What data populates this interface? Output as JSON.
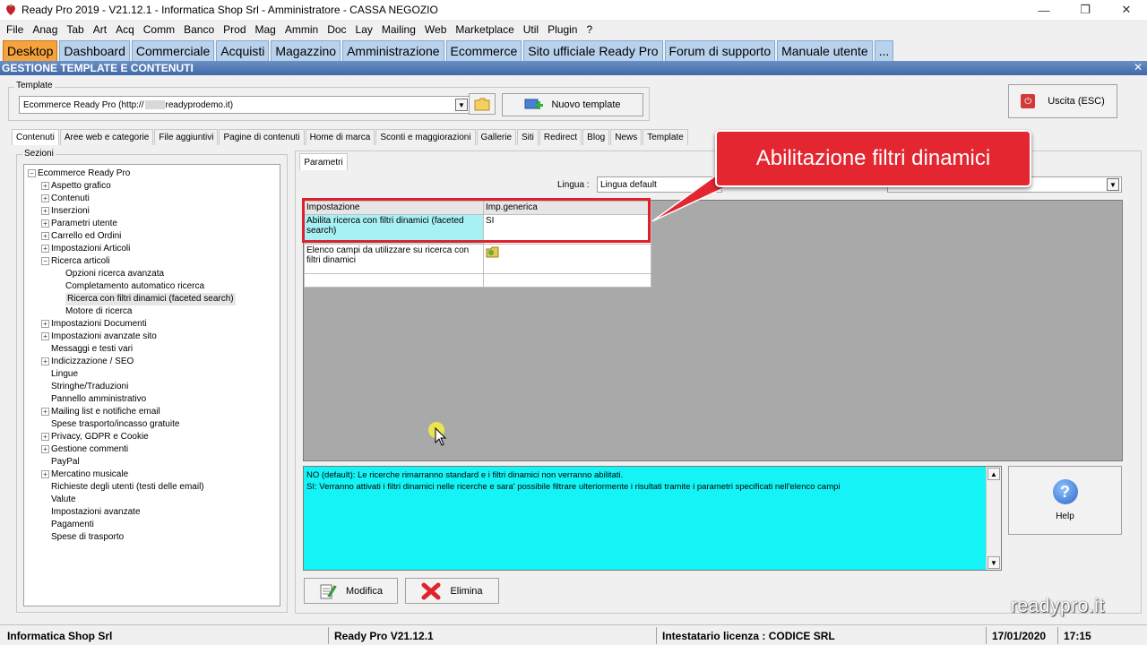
{
  "titlebar": {
    "title": "Ready Pro 2019 - V21.12.1 - Informatica Shop Srl - Amministratore - CASSA NEGOZIO",
    "minimize": "—",
    "restore": "❐",
    "close": "✕"
  },
  "menu": [
    "File",
    "Anag",
    "Tab",
    "Art",
    "Acq",
    "Comm",
    "Banco",
    "Prod",
    "Mag",
    "Ammin",
    "Doc",
    "Lay",
    "Mailing",
    "Web",
    "Marketplace",
    "Util",
    "Plugin",
    "?"
  ],
  "main_tabs": [
    "Desktop",
    "Dashboard",
    "Commerciale",
    "Acquisti",
    "Magazzino",
    "Amministrazione",
    "Ecommerce",
    "Sito ufficiale Ready Pro",
    "Forum di supporto",
    "Manuale utente",
    "..."
  ],
  "section_header": {
    "title": "GESTIONE TEMPLATE E CONTENUTI",
    "close": "✕"
  },
  "template": {
    "legend": "Template",
    "value_prefix": "Ecommerce Ready Pro (http://",
    "value_suffix": "readyprodemo.it)",
    "new_button": "Nuovo template"
  },
  "exit_button": "Uscita (ESC)",
  "sub_tabs": [
    "Contenuti",
    "Aree web e categorie",
    "File aggiuntivi",
    "Pagine di contenuti",
    "Home di marca",
    "Sconti e maggiorazioni",
    "Gallerie",
    "Siti",
    "Redirect",
    "Blog",
    "News",
    "Template"
  ],
  "sections": {
    "legend": "Sezioni",
    "tree": [
      {
        "label": "Ecommerce Ready Pro",
        "level": 0,
        "expander": "−"
      },
      {
        "label": "Aspetto grafico",
        "level": 1,
        "expander": "+"
      },
      {
        "label": "Contenuti",
        "level": 1,
        "expander": "+"
      },
      {
        "label": "Inserzioni",
        "level": 1,
        "expander": "+"
      },
      {
        "label": "Parametri utente",
        "level": 1,
        "expander": "+"
      },
      {
        "label": "Carrello ed Ordini",
        "level": 1,
        "expander": "+"
      },
      {
        "label": "Impostazioni Articoli",
        "level": 1,
        "expander": "+"
      },
      {
        "label": "Ricerca articoli",
        "level": 1,
        "expander": "−"
      },
      {
        "label": "Opzioni ricerca avanzata",
        "level": 2,
        "expander": ""
      },
      {
        "label": "Completamento automatico ricerca",
        "level": 2,
        "expander": ""
      },
      {
        "label": "Ricerca con filtri dinamici (faceted search)",
        "level": 2,
        "expander": "",
        "selected": true
      },
      {
        "label": "Motore di ricerca",
        "level": 2,
        "expander": ""
      },
      {
        "label": "Impostazioni Documenti",
        "level": 1,
        "expander": "+"
      },
      {
        "label": "Impostazioni avanzate sito",
        "level": 1,
        "expander": "+"
      },
      {
        "label": "Messaggi e testi vari",
        "level": 1,
        "expander": ""
      },
      {
        "label": "Indicizzazione / SEO",
        "level": 1,
        "expander": "+"
      },
      {
        "label": "Lingue",
        "level": 1,
        "expander": ""
      },
      {
        "label": "Stringhe/Traduzioni",
        "level": 1,
        "expander": ""
      },
      {
        "label": "Pannello amministrativo",
        "level": 1,
        "expander": ""
      },
      {
        "label": "Mailing list e notifiche email",
        "level": 1,
        "expander": "+"
      },
      {
        "label": "Spese trasporto/incasso gratuite",
        "level": 1,
        "expander": ""
      },
      {
        "label": "Privacy, GDPR e Cookie",
        "level": 1,
        "expander": "+"
      },
      {
        "label": "Gestione commenti",
        "level": 1,
        "expander": "+"
      },
      {
        "label": "PayPal",
        "level": 1,
        "expander": ""
      },
      {
        "label": "Mercatino musicale",
        "level": 1,
        "expander": "+"
      },
      {
        "label": "Richieste degli utenti (testi delle email)",
        "level": 1,
        "expander": ""
      },
      {
        "label": "Valute",
        "level": 1,
        "expander": ""
      },
      {
        "label": "Impostazioni avanzate",
        "level": 1,
        "expander": ""
      },
      {
        "label": "Pagamenti",
        "level": 1,
        "expander": ""
      },
      {
        "label": "Spese di trasporto",
        "level": 1,
        "expander": ""
      }
    ]
  },
  "params": {
    "tab_label": "Parametri",
    "language_label": "Lingua :",
    "language_value": "Lingua default",
    "grid": {
      "headers": [
        "Impostazione",
        "Imp.generica"
      ],
      "rows": [
        {
          "setting": "Abilita ricerca con filtri dinamici (faceted search)",
          "value": "SI"
        },
        {
          "setting": "Elenco campi da utilizzare su ricerca con filtri dinamici",
          "value": ""
        },
        {
          "setting": "",
          "value": ""
        }
      ]
    },
    "description_line1": "NO (default): Le ricerche rimarranno standard e i filtri dinamici non verranno abilitati.",
    "description_line2": "SI: Verranno attivati i filtri dinamici nelle ricerche e sara' possibile filtrare ulteriormente i risultati tramite i parametri specificati nell'elenco campi"
  },
  "callout": "Abilitazione filtri dinamici",
  "buttons": {
    "help": "Help",
    "modifica": "Modifica",
    "elimina": "Elimina"
  },
  "watermark": "readypro.it",
  "statusbar": {
    "company": "Informatica Shop Srl",
    "version": "Ready Pro V21.12.1",
    "license": "Intestatario licenza : CODICE SRL",
    "date": "17/01/2020",
    "time": "17:15"
  },
  "colors": {
    "active_tab": "#f7a33c",
    "tab": "#b8d2ee",
    "section_header": "#4169a8",
    "highlight_box": "#e0202a",
    "callout": "#e32630",
    "description_bg": "#14f4f6",
    "selected_row": "#a7f0f4"
  }
}
